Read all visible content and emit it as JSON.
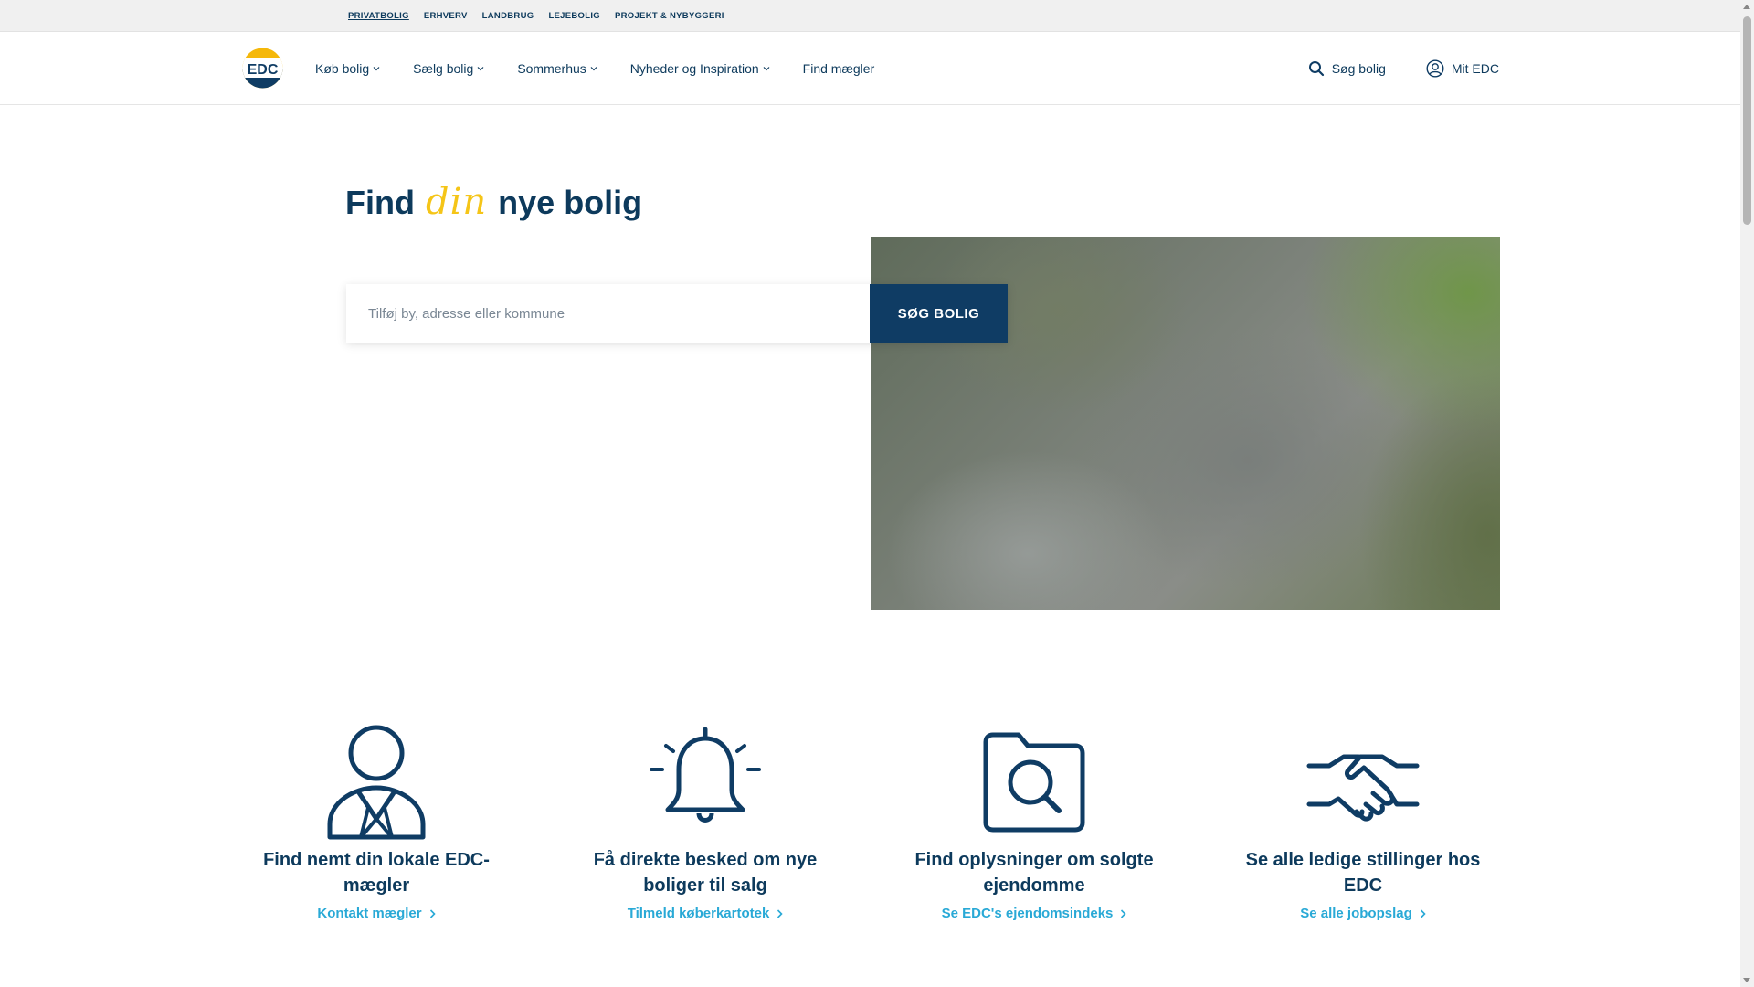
{
  "topbar": {
    "links": [
      {
        "label": "PRIVATBOLIG",
        "active": true
      },
      {
        "label": "ERHVERV"
      },
      {
        "label": "LANDBRUG"
      },
      {
        "label": "LEJEBOLIG"
      },
      {
        "label": "PROJEKT & NYBYGGERI"
      }
    ]
  },
  "nav": {
    "logo_text": "EDC",
    "items": [
      {
        "label": "Køb bolig",
        "has_dropdown": true
      },
      {
        "label": "Sælg bolig",
        "has_dropdown": true
      },
      {
        "label": "Sommerhus",
        "has_dropdown": true
      },
      {
        "label": "Nyheder og Inspiration",
        "has_dropdown": true
      },
      {
        "label": "Find mægler",
        "has_dropdown": false
      }
    ],
    "search_label": "Søg bolig",
    "account_label": "Mit EDC"
  },
  "hero": {
    "title_before": "Find",
    "title_script": "din",
    "title_after": "nye bolig",
    "search_placeholder": "Tilføj by, adresse eller kommune",
    "search_value": "",
    "search_button": "SØG BOLIG"
  },
  "features": [
    {
      "icon": "agent-icon",
      "title": "Find nemt din lokale EDC-mægler",
      "link": "Kontakt mægler"
    },
    {
      "icon": "bell-icon",
      "title": "Få direkte besked om nye boliger til salg",
      "link": "Tilmeld køberkartotek"
    },
    {
      "icon": "folder-search-icon",
      "title": "Find oplysninger om solgte ejendomme",
      "link": "Se EDC's ejendomsindeks"
    },
    {
      "icon": "handshake-icon",
      "title": "Se alle ledige stillinger hos EDC",
      "link": "Se alle jobopslag"
    }
  ],
  "colors": {
    "navy": "#0d3a5c",
    "button": "#0f3c64",
    "link": "#29a9d6",
    "accent_yellow": "#f5c518"
  }
}
